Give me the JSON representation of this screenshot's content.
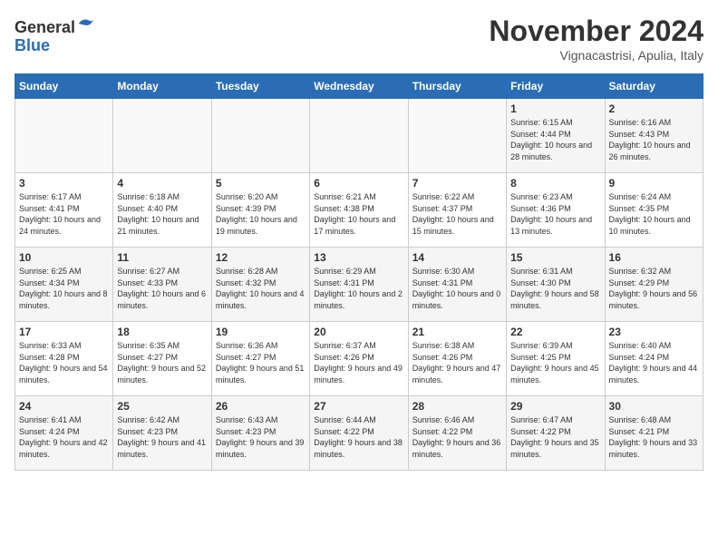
{
  "logo": {
    "general": "General",
    "blue": "Blue"
  },
  "title": "November 2024",
  "subtitle": "Vignacastrisi, Apulia, Italy",
  "headers": [
    "Sunday",
    "Monday",
    "Tuesday",
    "Wednesday",
    "Thursday",
    "Friday",
    "Saturday"
  ],
  "weeks": [
    [
      {
        "day": "",
        "info": ""
      },
      {
        "day": "",
        "info": ""
      },
      {
        "day": "",
        "info": ""
      },
      {
        "day": "",
        "info": ""
      },
      {
        "day": "",
        "info": ""
      },
      {
        "day": "1",
        "info": "Sunrise: 6:15 AM\nSunset: 4:44 PM\nDaylight: 10 hours and 28 minutes."
      },
      {
        "day": "2",
        "info": "Sunrise: 6:16 AM\nSunset: 4:43 PM\nDaylight: 10 hours and 26 minutes."
      }
    ],
    [
      {
        "day": "3",
        "info": "Sunrise: 6:17 AM\nSunset: 4:41 PM\nDaylight: 10 hours and 24 minutes."
      },
      {
        "day": "4",
        "info": "Sunrise: 6:18 AM\nSunset: 4:40 PM\nDaylight: 10 hours and 21 minutes."
      },
      {
        "day": "5",
        "info": "Sunrise: 6:20 AM\nSunset: 4:39 PM\nDaylight: 10 hours and 19 minutes."
      },
      {
        "day": "6",
        "info": "Sunrise: 6:21 AM\nSunset: 4:38 PM\nDaylight: 10 hours and 17 minutes."
      },
      {
        "day": "7",
        "info": "Sunrise: 6:22 AM\nSunset: 4:37 PM\nDaylight: 10 hours and 15 minutes."
      },
      {
        "day": "8",
        "info": "Sunrise: 6:23 AM\nSunset: 4:36 PM\nDaylight: 10 hours and 13 minutes."
      },
      {
        "day": "9",
        "info": "Sunrise: 6:24 AM\nSunset: 4:35 PM\nDaylight: 10 hours and 10 minutes."
      }
    ],
    [
      {
        "day": "10",
        "info": "Sunrise: 6:25 AM\nSunset: 4:34 PM\nDaylight: 10 hours and 8 minutes."
      },
      {
        "day": "11",
        "info": "Sunrise: 6:27 AM\nSunset: 4:33 PM\nDaylight: 10 hours and 6 minutes."
      },
      {
        "day": "12",
        "info": "Sunrise: 6:28 AM\nSunset: 4:32 PM\nDaylight: 10 hours and 4 minutes."
      },
      {
        "day": "13",
        "info": "Sunrise: 6:29 AM\nSunset: 4:31 PM\nDaylight: 10 hours and 2 minutes."
      },
      {
        "day": "14",
        "info": "Sunrise: 6:30 AM\nSunset: 4:31 PM\nDaylight: 10 hours and 0 minutes."
      },
      {
        "day": "15",
        "info": "Sunrise: 6:31 AM\nSunset: 4:30 PM\nDaylight: 9 hours and 58 minutes."
      },
      {
        "day": "16",
        "info": "Sunrise: 6:32 AM\nSunset: 4:29 PM\nDaylight: 9 hours and 56 minutes."
      }
    ],
    [
      {
        "day": "17",
        "info": "Sunrise: 6:33 AM\nSunset: 4:28 PM\nDaylight: 9 hours and 54 minutes."
      },
      {
        "day": "18",
        "info": "Sunrise: 6:35 AM\nSunset: 4:27 PM\nDaylight: 9 hours and 52 minutes."
      },
      {
        "day": "19",
        "info": "Sunrise: 6:36 AM\nSunset: 4:27 PM\nDaylight: 9 hours and 51 minutes."
      },
      {
        "day": "20",
        "info": "Sunrise: 6:37 AM\nSunset: 4:26 PM\nDaylight: 9 hours and 49 minutes."
      },
      {
        "day": "21",
        "info": "Sunrise: 6:38 AM\nSunset: 4:26 PM\nDaylight: 9 hours and 47 minutes."
      },
      {
        "day": "22",
        "info": "Sunrise: 6:39 AM\nSunset: 4:25 PM\nDaylight: 9 hours and 45 minutes."
      },
      {
        "day": "23",
        "info": "Sunrise: 6:40 AM\nSunset: 4:24 PM\nDaylight: 9 hours and 44 minutes."
      }
    ],
    [
      {
        "day": "24",
        "info": "Sunrise: 6:41 AM\nSunset: 4:24 PM\nDaylight: 9 hours and 42 minutes."
      },
      {
        "day": "25",
        "info": "Sunrise: 6:42 AM\nSunset: 4:23 PM\nDaylight: 9 hours and 41 minutes."
      },
      {
        "day": "26",
        "info": "Sunrise: 6:43 AM\nSunset: 4:23 PM\nDaylight: 9 hours and 39 minutes."
      },
      {
        "day": "27",
        "info": "Sunrise: 6:44 AM\nSunset: 4:22 PM\nDaylight: 9 hours and 38 minutes."
      },
      {
        "day": "28",
        "info": "Sunrise: 6:46 AM\nSunset: 4:22 PM\nDaylight: 9 hours and 36 minutes."
      },
      {
        "day": "29",
        "info": "Sunrise: 6:47 AM\nSunset: 4:22 PM\nDaylight: 9 hours and 35 minutes."
      },
      {
        "day": "30",
        "info": "Sunrise: 6:48 AM\nSunset: 4:21 PM\nDaylight: 9 hours and 33 minutes."
      }
    ]
  ]
}
